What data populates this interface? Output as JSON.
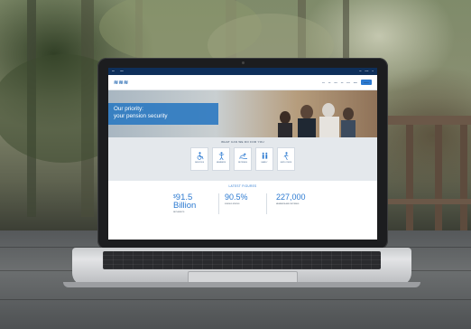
{
  "site": {
    "hero_line1": "Our priority:",
    "hero_line2": "your pension security",
    "services_title": "WHAT CAN WE DO FOR YOU",
    "stats_title": "LATEST FIGURES",
    "stats": [
      {
        "prefix": "$",
        "value": "91.5",
        "unit": "Billion",
        "desc": "NET ASSETS"
      },
      {
        "value": "90.5%",
        "desc": "FUNDED STATUS"
      },
      {
        "value": "227,000",
        "desc": "MEMBERS AND RETIREES"
      }
    ],
    "tiles": [
      {
        "icon": "wheelchair-icon",
        "label": "SERVICES"
      },
      {
        "icon": "person-icon",
        "label": "MEMBERS"
      },
      {
        "icon": "swimmer-icon",
        "label": "RETIREES"
      },
      {
        "icon": "family-icon",
        "label": "FAMILY"
      },
      {
        "icon": "walker-icon",
        "label": "EMPLOYERS"
      }
    ]
  },
  "colors": {
    "accent": "#2c7ad1",
    "topbar": "#0e2f5a"
  }
}
